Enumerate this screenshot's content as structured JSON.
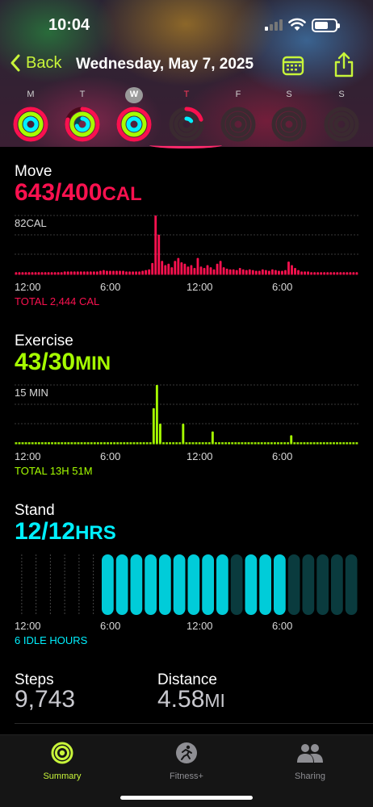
{
  "status_bar": {
    "time": "10:04"
  },
  "nav": {
    "back_label": "Back",
    "title": "Wednesday, May 7, 2025"
  },
  "week": [
    {
      "letter": "M",
      "state": "normal",
      "move": 1.0,
      "exercise": 1.0,
      "stand": 1.0,
      "dim": false
    },
    {
      "letter": "T",
      "state": "normal",
      "move": 0.8,
      "exercise": 1.0,
      "stand": 0.7,
      "dim": false
    },
    {
      "letter": "W",
      "state": "selected",
      "move": 1.0,
      "exercise": 1.0,
      "stand": 1.0,
      "dim": false
    },
    {
      "letter": "T",
      "state": "today",
      "move": 0.2,
      "exercise": 0.0,
      "stand": 0.15,
      "dim": true
    },
    {
      "letter": "F",
      "state": "normal",
      "move": 0.0,
      "exercise": 0.0,
      "stand": 0.0,
      "dim": true
    },
    {
      "letter": "S",
      "state": "normal",
      "move": 0.0,
      "exercise": 0.0,
      "stand": 0.0,
      "dim": true
    },
    {
      "letter": "S",
      "state": "normal",
      "move": 0.0,
      "exercise": 0.0,
      "stand": 0.0,
      "dim": true
    }
  ],
  "move": {
    "label": "Move",
    "value": "643/400",
    "unit": "CAL",
    "max_label": "82CAL",
    "x_ticks": [
      "12:00",
      "6:00",
      "12:00",
      "6:00"
    ],
    "total": "TOTAL 2,444 CAL",
    "color": "#fa114f"
  },
  "exercise": {
    "label": "Exercise",
    "value": "43/30",
    "unit": "MIN",
    "max_label": "15 MIN",
    "x_ticks": [
      "12:00",
      "6:00",
      "12:00",
      "6:00"
    ],
    "total": "TOTAL 13H 51M",
    "color": "#a6ff00"
  },
  "stand": {
    "label": "Stand",
    "value": "12/12",
    "unit": "HRS",
    "x_ticks": [
      "12:00",
      "6:00",
      "12:00",
      "6:00"
    ],
    "total": "6 IDLE HOURS",
    "color": "#00f0ff"
  },
  "steps": {
    "label": "Steps",
    "value": "9,743"
  },
  "distance": {
    "label": "Distance",
    "value": "4.58",
    "unit": "MI"
  },
  "tabs": [
    {
      "label": "Summary",
      "icon": "activity-rings-icon",
      "active": true
    },
    {
      "label": "Fitness+",
      "icon": "fitness-plus-icon",
      "active": false
    },
    {
      "label": "Sharing",
      "icon": "sharing-people-icon",
      "active": false
    }
  ],
  "chart_data": [
    {
      "type": "bar",
      "title": "Move",
      "x": [
        "12:00",
        "6:00",
        "12:00",
        "6:00"
      ],
      "y_max": 82,
      "ylabel": "CAL",
      "hourly_peak_values": [
        2,
        2,
        2,
        2,
        2,
        2,
        2,
        2,
        2,
        2,
        2,
        2,
        2,
        2,
        2,
        3,
        3,
        3,
        3,
        3,
        3,
        3,
        3,
        3,
        3,
        3,
        4,
        5,
        4,
        4,
        4,
        4,
        4,
        4,
        3,
        3,
        3,
        3,
        3,
        4,
        5,
        6,
        15,
        82,
        55,
        18,
        12,
        14,
        9,
        18,
        22,
        16,
        14,
        10,
        12,
        8,
        22,
        10,
        8,
        12,
        9,
        6,
        14,
        18,
        9,
        7,
        6,
        6,
        5,
        8,
        6,
        5,
        6,
        5,
        4,
        4,
        6,
        5,
        4,
        6,
        5,
        4,
        4,
        5,
        17,
        12,
        8,
        5,
        3,
        3,
        3,
        2,
        2,
        2,
        2,
        2,
        2,
        2,
        2,
        2,
        2,
        2,
        2,
        2,
        2,
        2
      ]
    },
    {
      "type": "bar",
      "title": "Exercise",
      "x": [
        "12:00",
        "6:00",
        "12:00",
        "6:00"
      ],
      "y_max": 15,
      "ylabel": "MIN",
      "hourly_peak_values": [
        0,
        0,
        0,
        0,
        0,
        0,
        0,
        0,
        0,
        0,
        0,
        0,
        0,
        0,
        0,
        0,
        0,
        0,
        0,
        0,
        0,
        0,
        0,
        0,
        0,
        0,
        0,
        0,
        0,
        0,
        0,
        0,
        0,
        0,
        0,
        0,
        0,
        0,
        0,
        0,
        0,
        0,
        9,
        15,
        5,
        0,
        0,
        0,
        0,
        0,
        0,
        5,
        0,
        0,
        0,
        0,
        0,
        0,
        0,
        0,
        3,
        0,
        0,
        0,
        0,
        0,
        0,
        0,
        0,
        0,
        0,
        0,
        0,
        0,
        0,
        0,
        0,
        0,
        0,
        1,
        0,
        0,
        0,
        0,
        2,
        0,
        0,
        0,
        0,
        0,
        0,
        0,
        0,
        0,
        0,
        0,
        0,
        0,
        0,
        0,
        0,
        0,
        0,
        0,
        0
      ]
    },
    {
      "type": "bar",
      "title": "Stand",
      "x": [
        "12:00",
        "6:00",
        "12:00",
        "6:00"
      ],
      "hours_stood": [
        0,
        0,
        0,
        0,
        0,
        0,
        1,
        1,
        1,
        1,
        1,
        1,
        1,
        1,
        1,
        0,
        1,
        1,
        1,
        0,
        0,
        0,
        0,
        0
      ],
      "values": [
        0,
        0,
        0,
        0,
        0,
        0,
        1,
        1,
        1,
        1,
        1,
        1,
        1,
        1,
        1,
        0,
        1,
        1,
        1,
        0,
        0,
        0,
        0,
        0
      ]
    }
  ]
}
